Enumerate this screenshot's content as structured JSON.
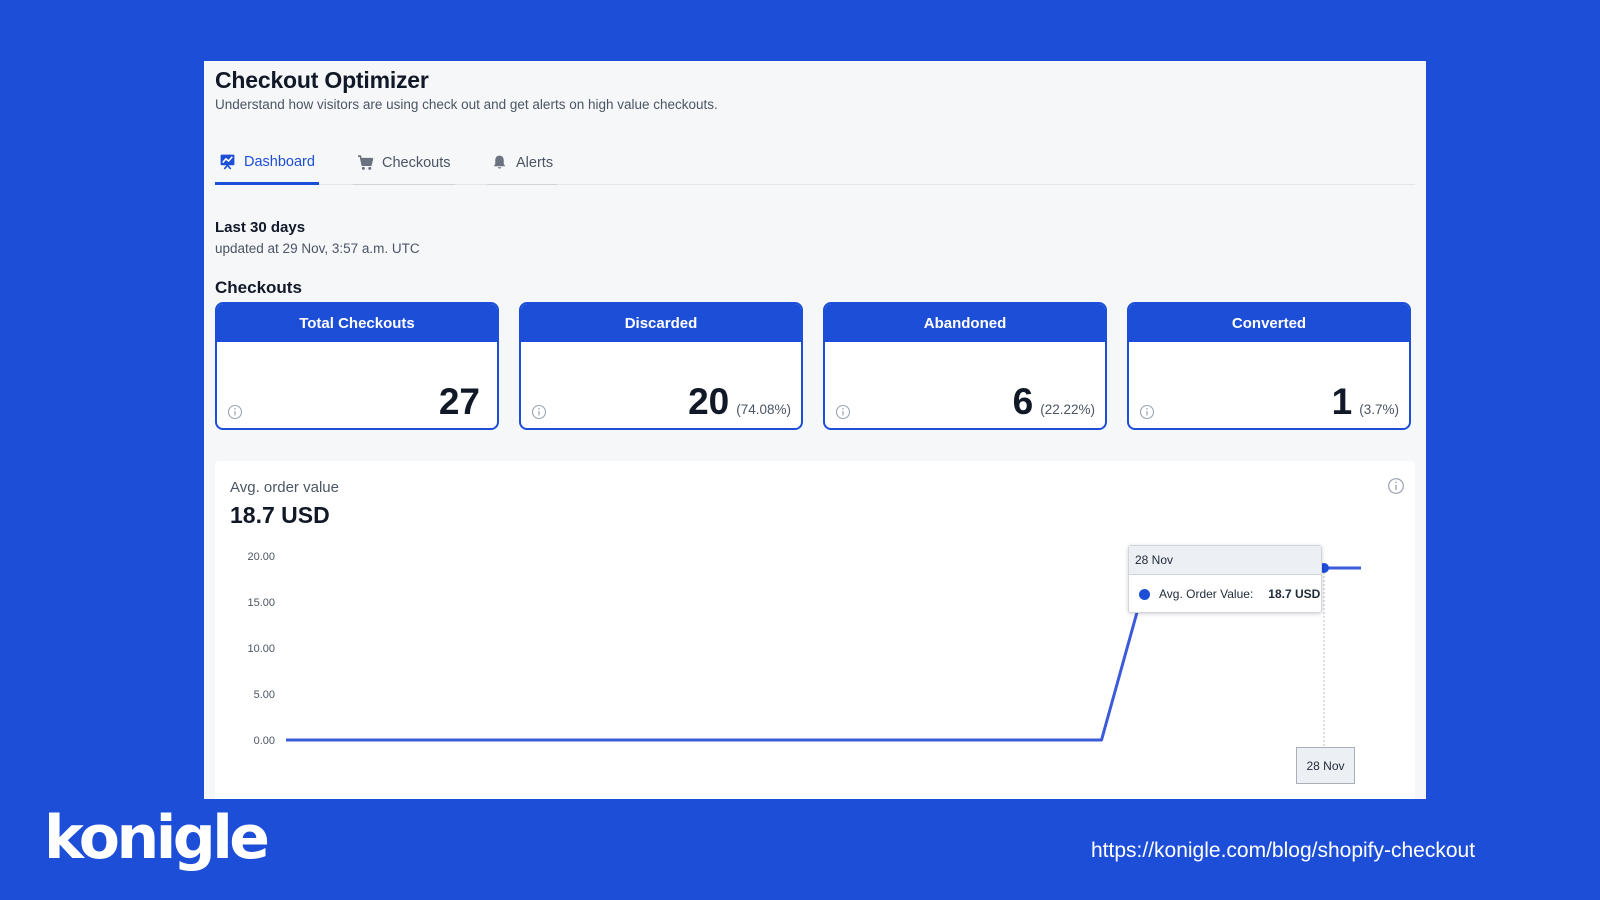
{
  "app": {
    "title": "Checkout Optimizer",
    "subtitle": "Understand how visitors are using check out and get alerts on high value checkouts."
  },
  "tabs": [
    {
      "label": "Dashboard",
      "icon": "dashboard-chart-icon",
      "active": true
    },
    {
      "label": "Checkouts",
      "icon": "cart-icon",
      "active": false
    },
    {
      "label": "Alerts",
      "icon": "bell-icon",
      "active": false
    }
  ],
  "period": {
    "title": "Last 30 days",
    "updated": "updated at 29 Nov, 3:57 a.m. UTC"
  },
  "section_title": "Checkouts",
  "cards": [
    {
      "title": "Total Checkouts",
      "value": "27",
      "pct": ""
    },
    {
      "title": "Discarded",
      "value": "20",
      "pct": "(74.08%)"
    },
    {
      "title": "Abandoned",
      "value": "6",
      "pct": "(22.22%)"
    },
    {
      "title": "Converted",
      "value": "1",
      "pct": "(3.7%)"
    }
  ],
  "avg_order": {
    "label": "Avg. order value",
    "value": "18.7 USD"
  },
  "tooltip": {
    "date": "28 Nov",
    "series_label": "Avg. Order Value:",
    "value": "18.7 USD"
  },
  "x_tooltip": "28 Nov",
  "chart_data": {
    "type": "line",
    "title": "",
    "xlabel": "",
    "ylabel": "",
    "y_ticks": [
      "20.00",
      "15.00",
      "10.00",
      "5.00",
      "0.00"
    ],
    "ylim": [
      0,
      20
    ],
    "x": [
      0,
      1,
      2,
      3,
      4,
      5,
      6,
      7,
      8,
      9,
      10,
      11,
      12,
      13,
      14,
      15,
      16,
      17,
      18,
      19,
      20,
      21,
      22,
      23,
      24,
      25,
      26,
      27,
      28,
      29
    ],
    "series": [
      {
        "values": [
          0,
          0,
          0,
          0,
          0,
          0,
          0,
          0,
          0,
          0,
          0,
          0,
          0,
          0,
          0,
          0,
          0,
          0,
          0,
          0,
          0,
          0,
          0,
          14.5,
          18.7,
          18.7,
          18.7,
          18.7,
          18.7,
          18.7
        ],
        "color": "#3b5bdb"
      }
    ],
    "highlight_index": 28,
    "grid": false
  },
  "footer": {
    "brand": "konigle",
    "url": "https://konigle.com/blog/shopify-checkout"
  },
  "colors": {
    "brand_blue": "#1d4ed8",
    "line": "#3b5bdb"
  }
}
